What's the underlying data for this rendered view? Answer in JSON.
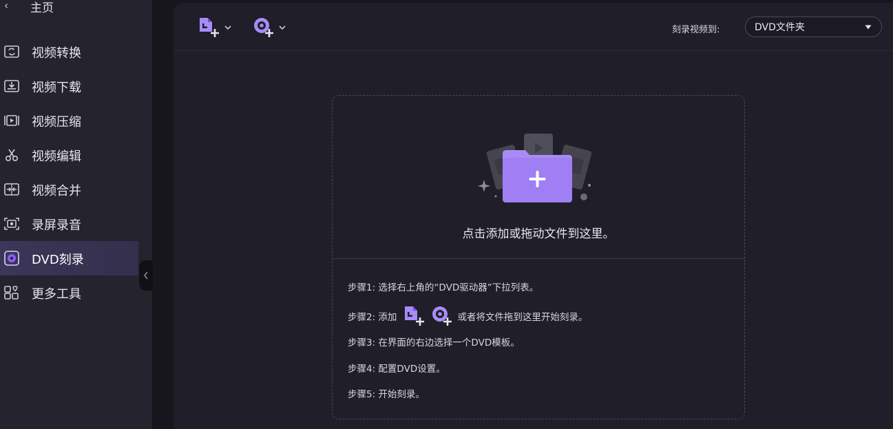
{
  "sidebar": {
    "home_label": "主页",
    "items": [
      {
        "label": "视频转换",
        "icon": "video-convert-icon"
      },
      {
        "label": "视频下载",
        "icon": "video-download-icon"
      },
      {
        "label": "视频压缩",
        "icon": "video-compress-icon"
      },
      {
        "label": "视频编辑",
        "icon": "scissors-icon"
      },
      {
        "label": "视频合并",
        "icon": "video-merge-icon"
      },
      {
        "label": "录屏录音",
        "icon": "screen-record-icon"
      },
      {
        "label": "DVD刻录",
        "icon": "dvd-disc-icon",
        "active": true
      },
      {
        "label": "更多工具",
        "icon": "more-tools-grid-icon"
      }
    ]
  },
  "toolbar": {
    "burn_to_label": "刻录视频到:",
    "burn_to_value": "DVD文件夹"
  },
  "dropzone": {
    "prompt": "点击添加或拖动文件到这里。",
    "steps": [
      "步骤1: 选择右上角的“DVD驱动器”下拉列表。",
      "步骤2: 添加",
      "或者将文件拖到这里开始刻录。",
      "步骤3: 在界面的右边选择一个DVD模板。",
      "步骤4: 配置DVD设置。",
      "步骤5: 开始刻录。"
    ]
  },
  "colors": {
    "accent": "#8b5cf6",
    "sidebar_bg": "#24232e",
    "main_bg": "#1f1e29",
    "active_item_bg": "#3c3658"
  }
}
